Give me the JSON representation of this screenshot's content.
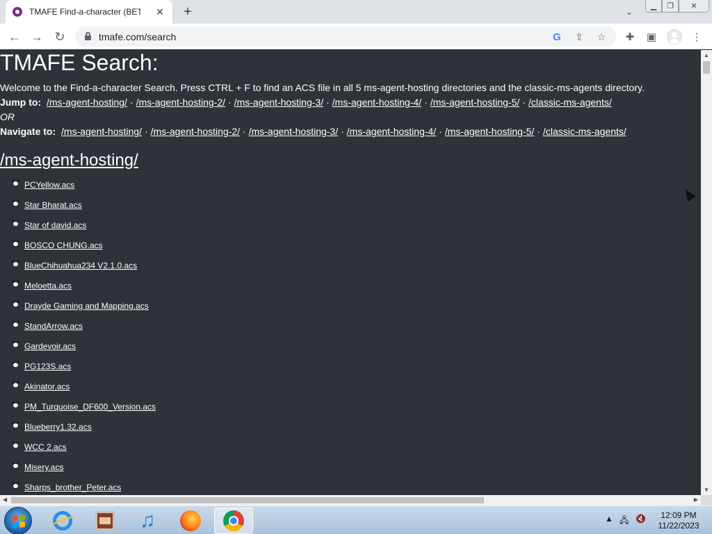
{
  "browser": {
    "tab_title": "TMAFE Find-a-character (BETA)",
    "tab_close": "✕",
    "new_tab": "+",
    "url": "tmafe.com/search"
  },
  "page": {
    "title": "TMAFE Search:",
    "intro": "Welcome to the Find-a-character Search. Press CTRL + F to find an ACS file in all 5 ms-agent-hosting directories and the classic-ms-agents directory.",
    "jump_label": "Jump to:",
    "or_label": "OR",
    "navigate_label": "Navigate to:",
    "separator": "·",
    "directories": [
      "/ms-agent-hosting/",
      "/ms-agent-hosting-2/",
      "/ms-agent-hosting-3/",
      "/ms-agent-hosting-4/",
      "/ms-agent-hosting-5/",
      "/classic-ms-agents/"
    ],
    "section_heading": "/ms-agent-hosting/",
    "files": [
      "PCYellow.acs",
      "Star Bharat.acs",
      "Star of david.acs",
      "BOSCO CHUNG.acs",
      "BlueChihuahua234 V2.1.0.acs",
      "Meloetta.acs",
      "Drayde Gaming and Mapping.acs",
      "StandArrow.acs",
      "Gardevoir.acs",
      "PG123S.acs",
      "Akinator.acs",
      "PM_Turquoise_DF600_Version.acs",
      "Blueberry1.32.acs",
      "WCC 2.acs",
      "Misery.acs",
      "Sharps_brother_Peter.acs"
    ]
  },
  "taskbar": {
    "time": "12:09 PM",
    "date": "11/22/2023"
  }
}
